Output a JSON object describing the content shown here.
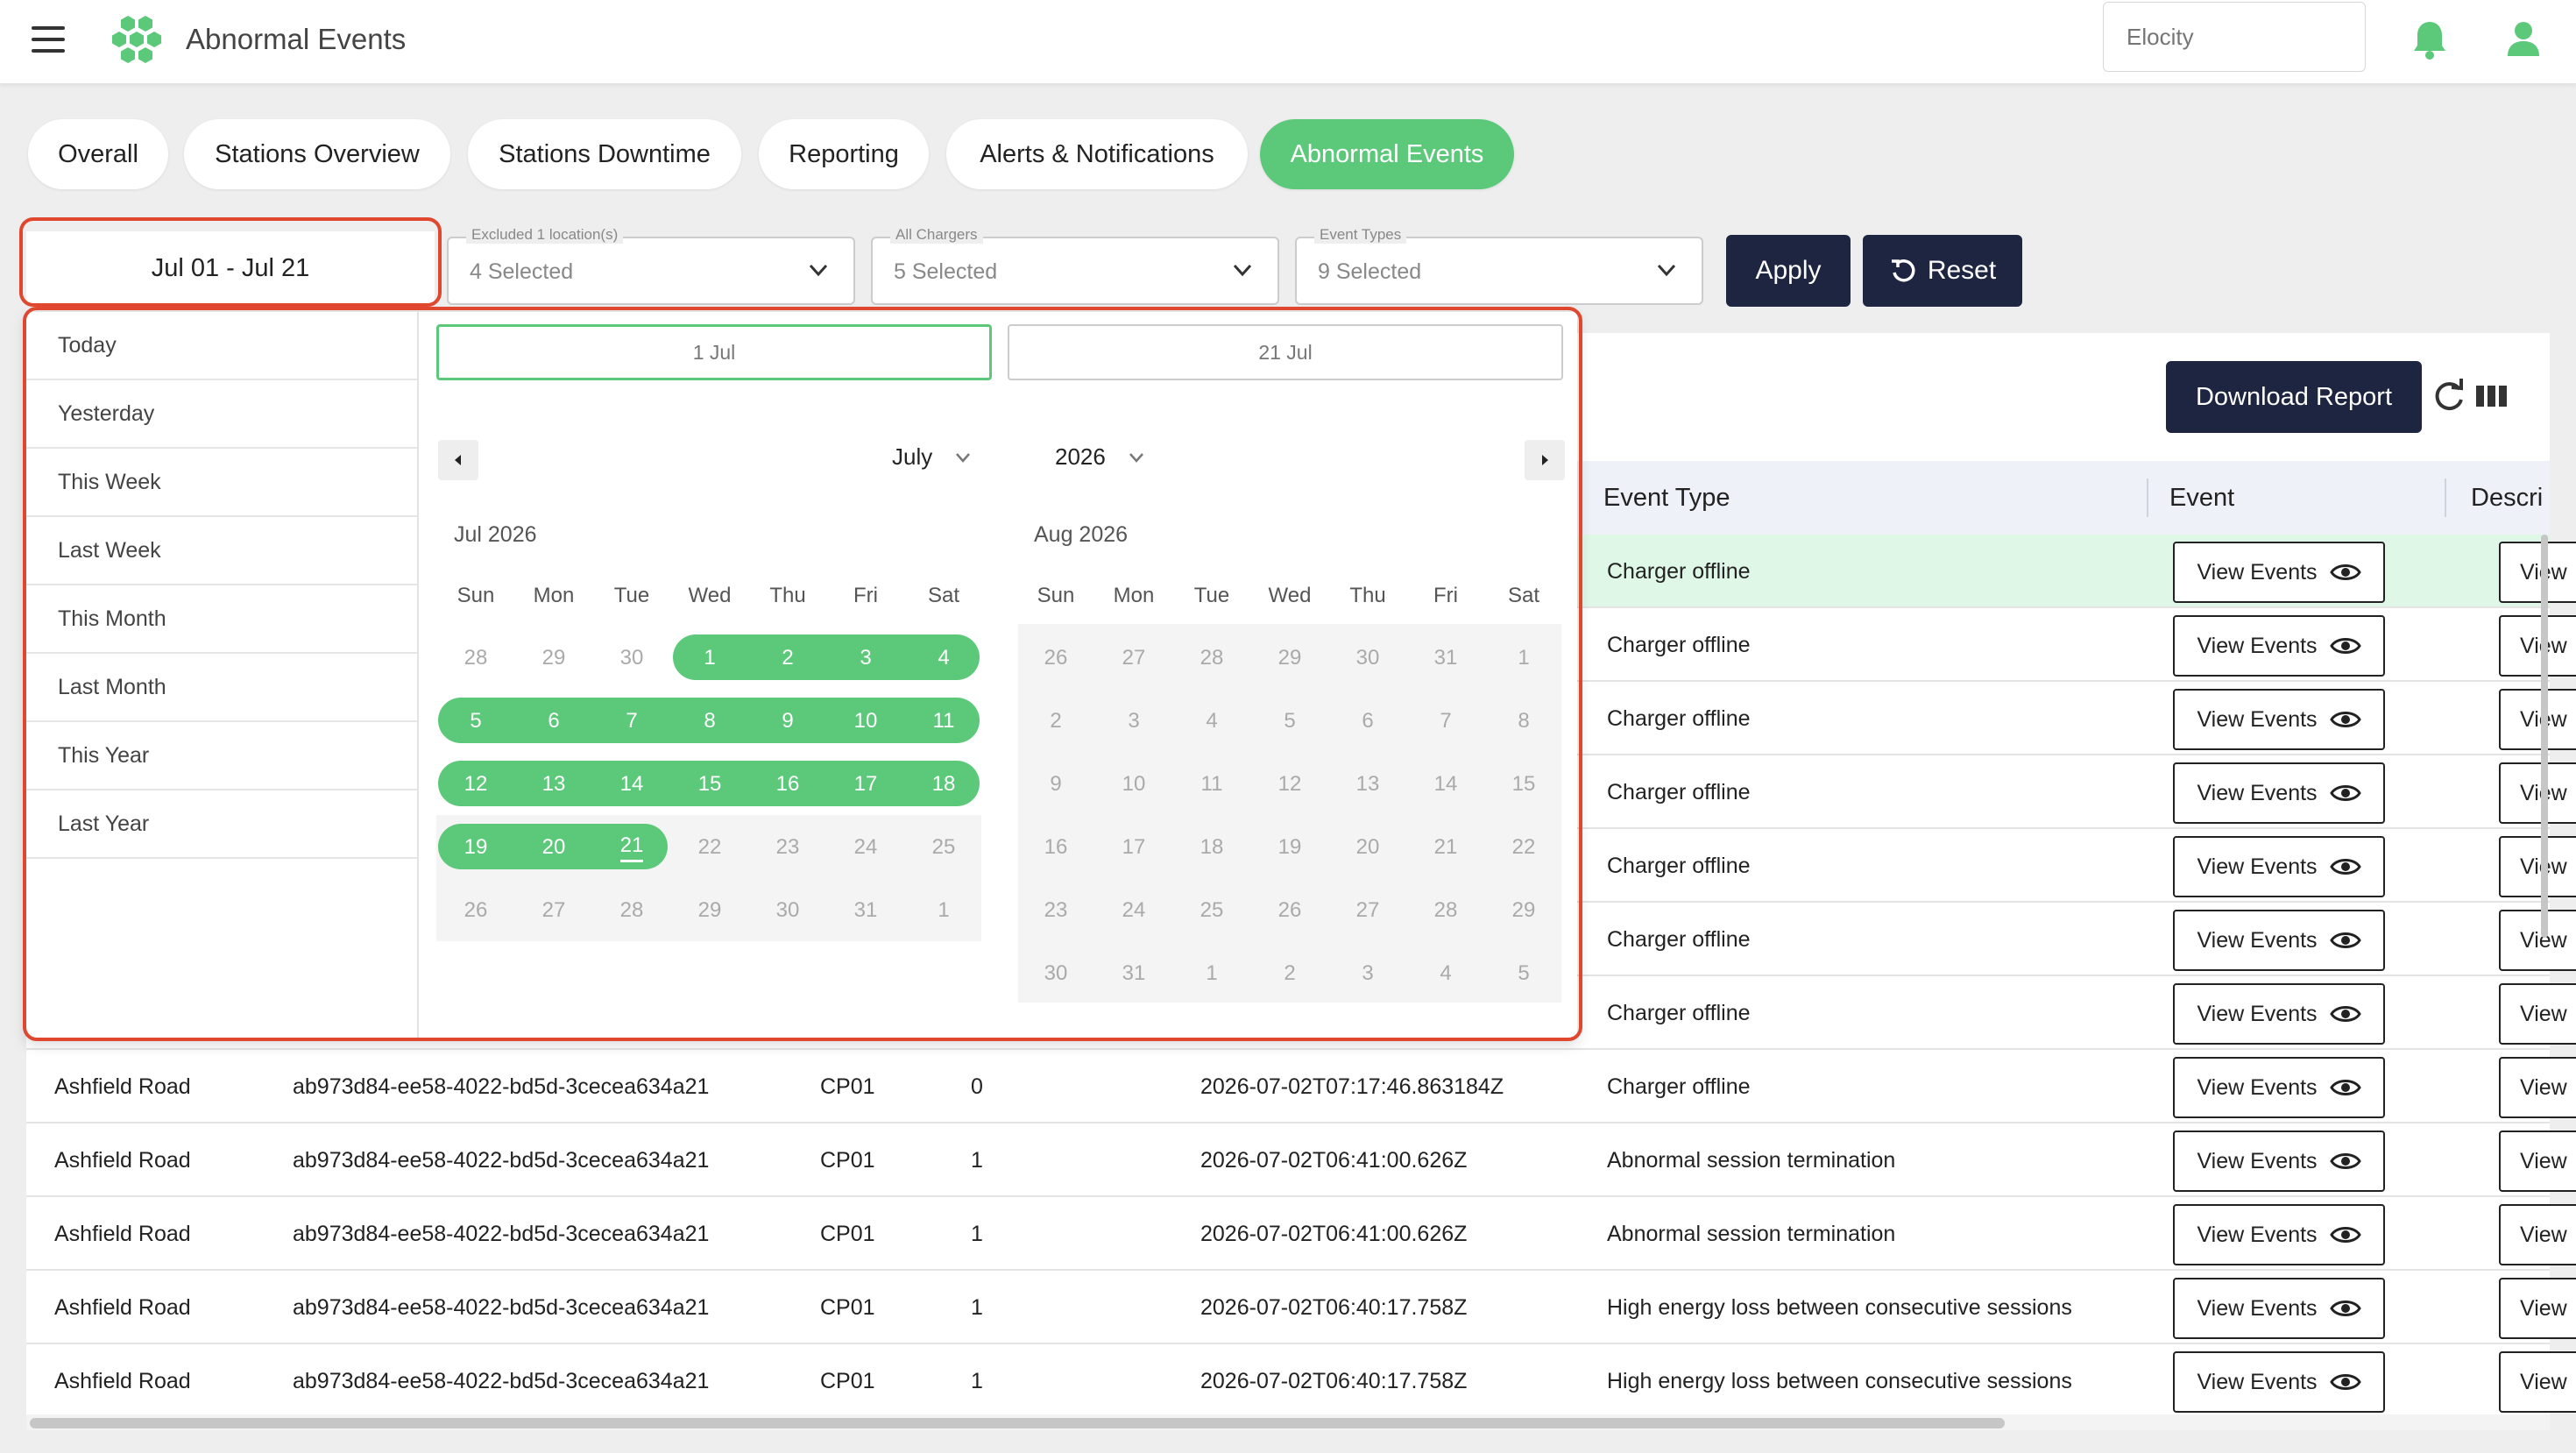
{
  "header": {
    "app_title": "Abnormal Events",
    "org_placeholder": "Elocity"
  },
  "tabs": [
    {
      "label": "Overall"
    },
    {
      "label": "Stations Overview"
    },
    {
      "label": "Stations Downtime"
    },
    {
      "label": "Reporting"
    },
    {
      "label": "Alerts & Notifications"
    },
    {
      "label": "Abnormal Events"
    }
  ],
  "active_tab": "Abnormal Events",
  "filters": {
    "date_range": "Jul 01 - Jul 21",
    "locations": {
      "label": "Excluded 1 location(s)",
      "value": "4 Selected"
    },
    "chargers": {
      "label": "All Chargers",
      "value": "5 Selected"
    },
    "event_types": {
      "label": "Event Types",
      "value": "9 Selected"
    },
    "apply_label": "Apply",
    "reset_label": "Reset"
  },
  "toolbar": {
    "download_label": "Download Report"
  },
  "picker": {
    "presets": [
      "Today",
      "Yesterday",
      "This Week",
      "Last Week",
      "This Month",
      "Last Month",
      "This Year",
      "Last Year"
    ],
    "start_date": "1 Jul",
    "end_date": "21 Jul",
    "month_select": "July",
    "year_select": "2026",
    "left_month_title": "Jul 2026",
    "right_month_title": "Aug 2026",
    "weekdays": [
      "Sun",
      "Mon",
      "Tue",
      "Wed",
      "Thu",
      "Fri",
      "Sat"
    ],
    "jul_days": [
      [
        "28",
        "29",
        "30",
        "1",
        "2",
        "3",
        "4"
      ],
      [
        "5",
        "6",
        "7",
        "8",
        "9",
        "10",
        "11"
      ],
      [
        "12",
        "13",
        "14",
        "15",
        "16",
        "17",
        "18"
      ],
      [
        "19",
        "20",
        "21",
        "22",
        "23",
        "24",
        "25"
      ],
      [
        "26",
        "27",
        "28",
        "29",
        "30",
        "31",
        "1"
      ]
    ],
    "aug_days": [
      [
        "26",
        "27",
        "28",
        "29",
        "30",
        "31",
        "1"
      ],
      [
        "2",
        "3",
        "4",
        "5",
        "6",
        "7",
        "8"
      ],
      [
        "9",
        "10",
        "11",
        "12",
        "13",
        "14",
        "15"
      ],
      [
        "16",
        "17",
        "18",
        "19",
        "20",
        "21",
        "22"
      ],
      [
        "23",
        "24",
        "25",
        "26",
        "27",
        "28",
        "29"
      ],
      [
        "30",
        "31",
        "1",
        "2",
        "3",
        "4",
        "5"
      ]
    ]
  },
  "table": {
    "headers": {
      "event_type": "Event Type",
      "event": "Event",
      "description": "Descri"
    },
    "view_label": "View Events",
    "view_label_short": "View",
    "hidden_rows": [
      {
        "event_type": "Charger offline"
      },
      {
        "event_type": "Charger offline"
      },
      {
        "event_type": "Charger offline"
      },
      {
        "event_type": "Charger offline"
      },
      {
        "event_type": "Charger offline"
      },
      {
        "event_type": "Charger offline"
      },
      {
        "event_type": "Charger offline"
      }
    ],
    "rows": [
      {
        "station": "Ashfield Road",
        "id": "ab973d84-ee58-4022-bd5d-3cecea634a21",
        "charger": "CP01",
        "connector": "0",
        "timestamp": "2026-07-02T07:17:46.863184Z",
        "event_type": "Charger offline"
      },
      {
        "station": "Ashfield Road",
        "id": "ab973d84-ee58-4022-bd5d-3cecea634a21",
        "charger": "CP01",
        "connector": "1",
        "timestamp": "2026-07-02T06:41:00.626Z",
        "event_type": "Abnormal session termination"
      },
      {
        "station": "Ashfield Road",
        "id": "ab973d84-ee58-4022-bd5d-3cecea634a21",
        "charger": "CP01",
        "connector": "1",
        "timestamp": "2026-07-02T06:41:00.626Z",
        "event_type": "Abnormal session termination"
      },
      {
        "station": "Ashfield Road",
        "id": "ab973d84-ee58-4022-bd5d-3cecea634a21",
        "charger": "CP01",
        "connector": "1",
        "timestamp": "2026-07-02T06:40:17.758Z",
        "event_type": "High energy loss between consecutive sessions"
      },
      {
        "station": "Ashfield Road",
        "id": "ab973d84-ee58-4022-bd5d-3cecea634a21",
        "charger": "CP01",
        "connector": "1",
        "timestamp": "2026-07-02T06:40:17.758Z",
        "event_type": "High energy loss between consecutive sessions"
      }
    ]
  },
  "colors": {
    "accent": "#5cc97a",
    "dark": "#1d2541",
    "highlight_border": "#e0472f"
  }
}
